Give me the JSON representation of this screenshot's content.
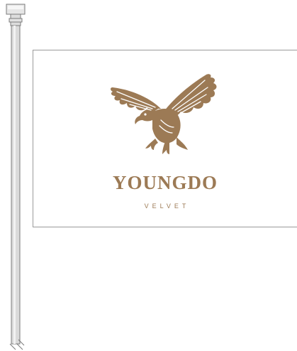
{
  "flag": {
    "brand_name": "YOUNGDO",
    "brand_sub": "VELVET",
    "brand_color": "#9c7a55",
    "background_color": "#ffffff",
    "emblem_icon": "eagle-icon"
  },
  "pole": {
    "color": "#d6d6d6",
    "outline_color": "#8a8a8a"
  }
}
